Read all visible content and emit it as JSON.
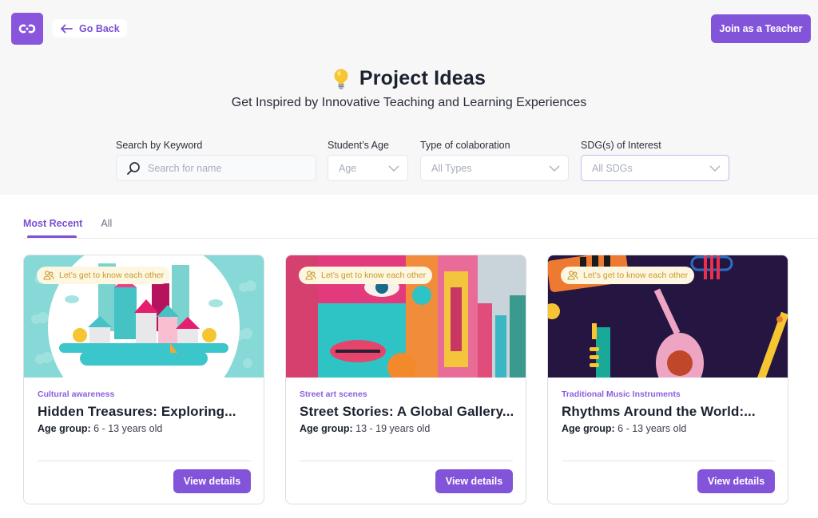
{
  "header": {
    "logo_icon": "infinity-link-icon",
    "back_label": "Go Back",
    "back_icon": "arrow-left-icon",
    "join_teacher_label": "Join as a Teacher"
  },
  "hero": {
    "title_icon": "lightbulb-icon",
    "title": "Project Ideas",
    "subtitle": "Get Inspired by Innovative Teaching and Learning Experiences"
  },
  "filters": {
    "keyword": {
      "label": "Search by Keyword",
      "placeholder": "Search for name",
      "value": "",
      "icon": "search-icon"
    },
    "age": {
      "label": "Student’s Age",
      "selected": "Age"
    },
    "collaboration": {
      "label": "Type of colaboration",
      "selected": "All Types"
    },
    "sdg": {
      "label": "SDG(s) of Interest",
      "selected": "All SDGs"
    }
  },
  "tabs": [
    {
      "label": "Most Recent",
      "active": true
    },
    {
      "label": "All",
      "active": false
    }
  ],
  "colors": {
    "brand": "#8254da",
    "badge_bg": "#fdf6e1",
    "badge_text": "#c99a2a"
  },
  "cards": [
    {
      "badge": "Let’s get to know each other",
      "badge_icon": "users-icon",
      "image": "illustrated-city-houses",
      "category": "Cultural awareness",
      "title": "Hidden Treasures: Exploring...",
      "age_label": "Age group:",
      "age_value": "6 - 13 years old",
      "button": "View details"
    },
    {
      "badge": "Let’s get to know each other",
      "badge_icon": "users-icon",
      "image": "street-art-murals",
      "category": "Street art scenes",
      "title": "Street Stories: A Global Gallery...",
      "age_label": "Age group:",
      "age_value": "13 - 19 years old",
      "button": "View details"
    },
    {
      "badge": "Let’s get to know each other",
      "badge_icon": "users-icon",
      "image": "music-instruments-pattern",
      "category": "Traditional Music Instruments",
      "title": "Rhythms Around the World:...",
      "age_label": "Age group:",
      "age_value": "6 - 13 years old",
      "button": "View details"
    }
  ]
}
